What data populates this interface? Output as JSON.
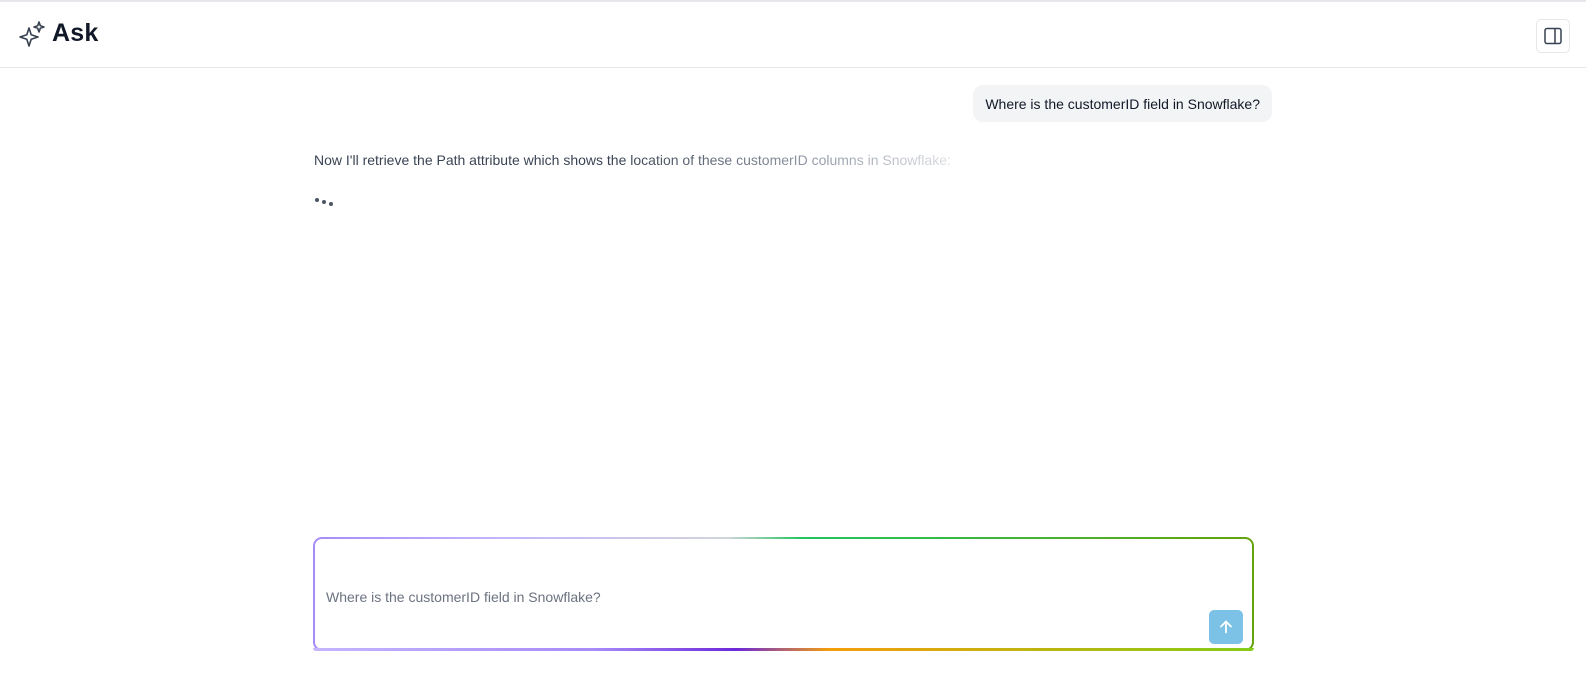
{
  "header": {
    "title": "Ask",
    "logo_icon": "sparkles-icon",
    "panel_toggle_icon": "sidebar-panel-icon"
  },
  "conversation": {
    "user_message": "Where is the customerID field in Snowflake?",
    "assistant_message": "Now I'll retrieve the Path attribute which shows the location of these customerID columns in Snowflake:",
    "typing_indicator_icon": "typing-dots-icon"
  },
  "composer": {
    "placeholder": "Where is the customerID field in Snowflake?",
    "value": "",
    "send_icon": "arrow-up-icon"
  },
  "colors": {
    "send_button": "#7cc1e6",
    "user_bubble_bg": "#f3f4f6",
    "gradient_border_start": "#a78bfa",
    "gradient_border_mid": "#22c55e",
    "gradient_border_end": "#65a30d"
  }
}
